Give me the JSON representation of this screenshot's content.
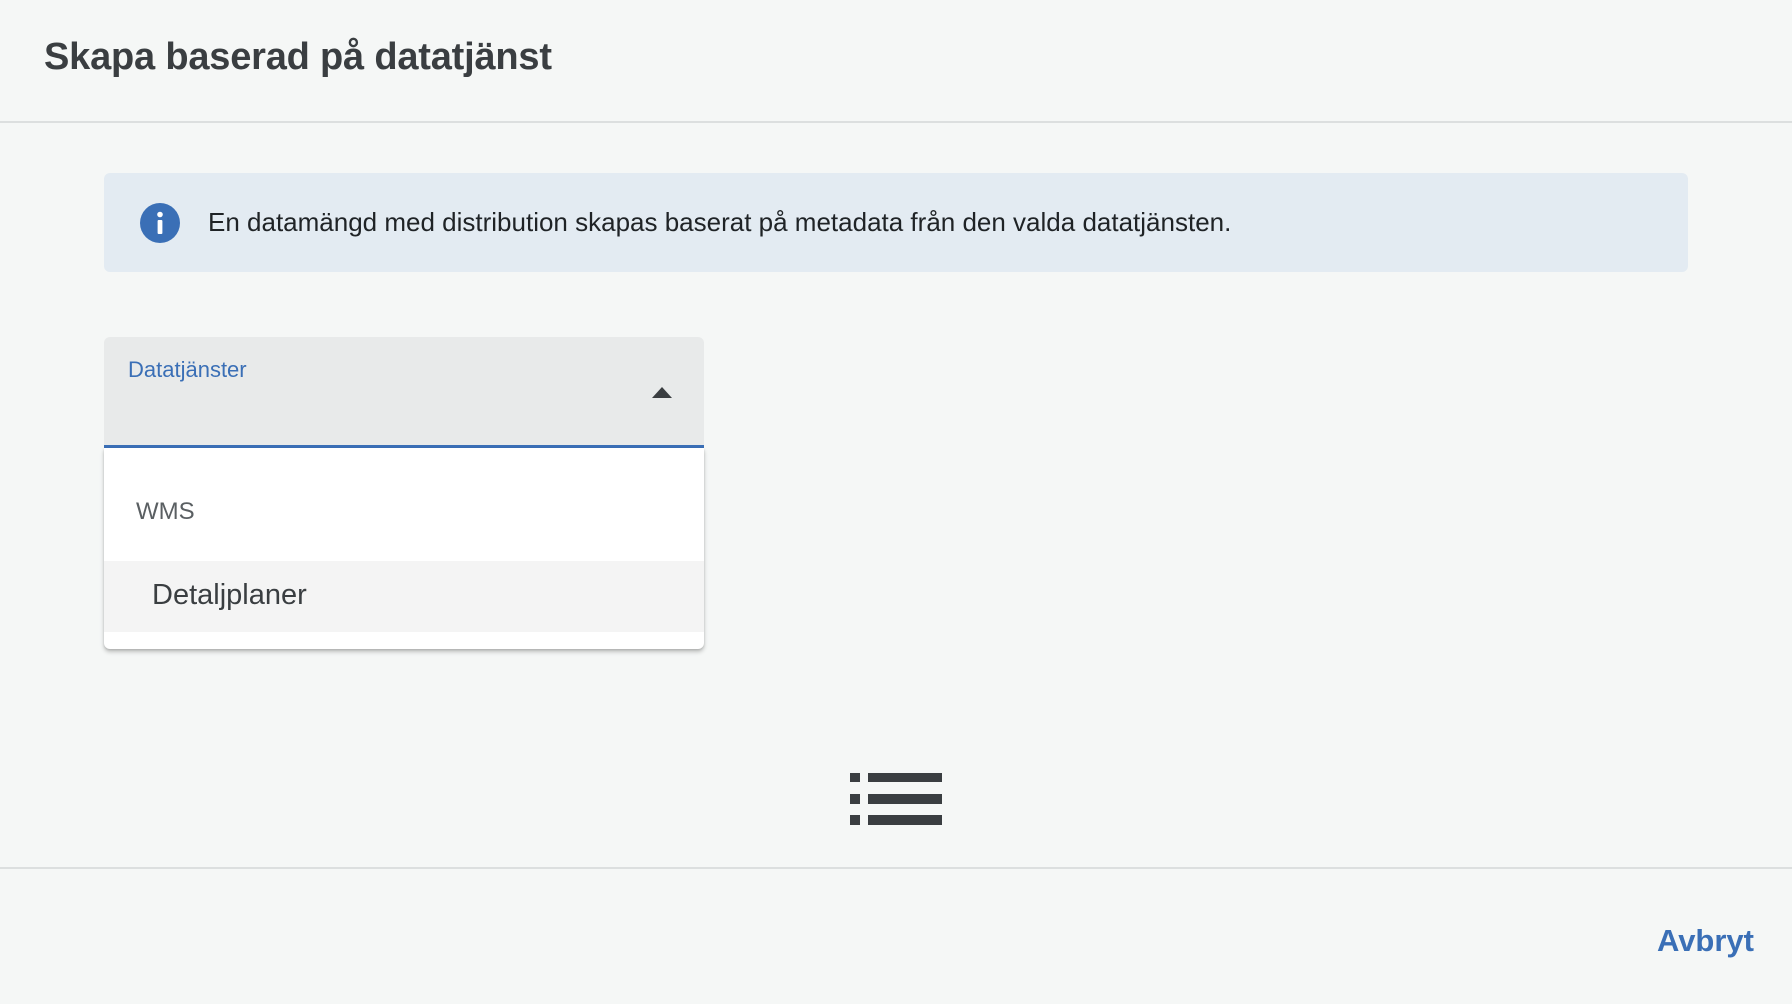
{
  "dialog": {
    "title": "Skapa baserad på datatjänst"
  },
  "info": {
    "icon": "info-icon",
    "text": "En datamängd med distribution skapas baserat på metadata från den valda datatjänsten.",
    "icon_color": "#3a6fb6"
  },
  "select": {
    "label": "Datatjänster",
    "value": "",
    "expanded": true,
    "arrow_icon": "caret-up-icon",
    "groups": [
      {
        "label": "WMS",
        "options": [
          {
            "label": "Detaljplaner",
            "highlighted": true
          }
        ]
      }
    ]
  },
  "center_icon": "list-icon",
  "footer": {
    "cancel_label": "Avbryt"
  },
  "colors": {
    "accent": "#3a6fb6",
    "background": "#f5f7f6",
    "info_background": "#e3ebf2"
  }
}
